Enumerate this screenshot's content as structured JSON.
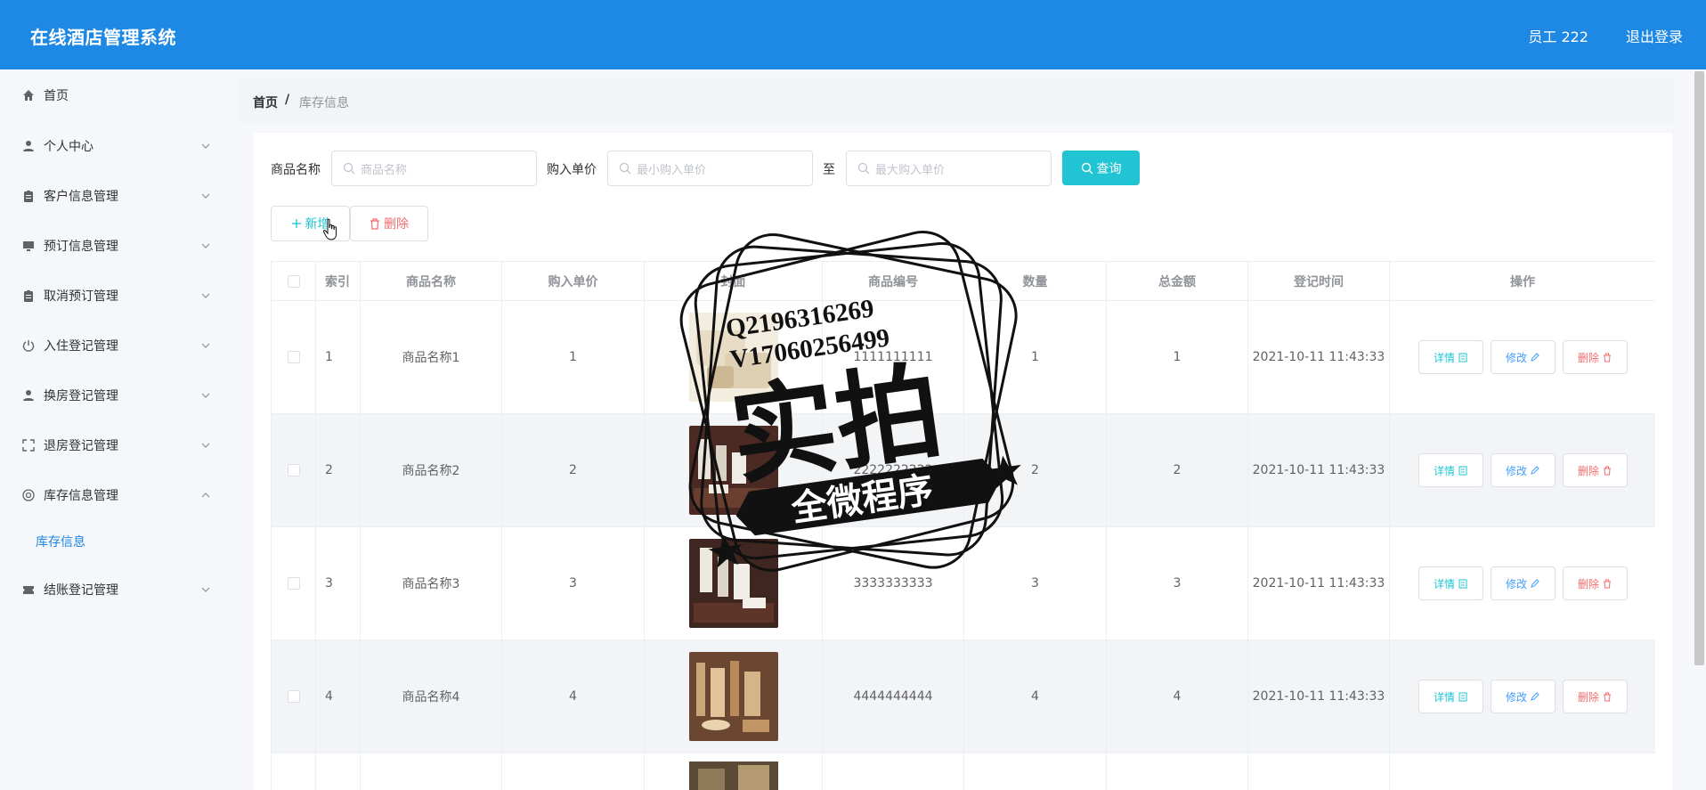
{
  "header": {
    "title": "在线酒店管理系统",
    "user": "员工 222",
    "logout": "退出登录"
  },
  "sidebar": {
    "items": [
      {
        "label": "首页",
        "icon": "home-icon",
        "expandable": false
      },
      {
        "label": "个人中心",
        "icon": "user-icon",
        "expandable": true
      },
      {
        "label": "客户信息管理",
        "icon": "clipboard-icon",
        "expandable": true
      },
      {
        "label": "预订信息管理",
        "icon": "monitor-icon",
        "expandable": true
      },
      {
        "label": "取消预订管理",
        "icon": "clipboard-icon",
        "expandable": true
      },
      {
        "label": "入住登记管理",
        "icon": "power-icon",
        "expandable": true
      },
      {
        "label": "换房登记管理",
        "icon": "user-icon",
        "expandable": true
      },
      {
        "label": "退房登记管理",
        "icon": "fullscreen-icon",
        "expandable": true
      },
      {
        "label": "库存信息管理",
        "icon": "gear-circle-icon",
        "expandable": true,
        "expanded": true
      },
      {
        "label": "结账登记管理",
        "icon": "ticket-icon",
        "expandable": true
      }
    ],
    "sub_item": "库存信息"
  },
  "breadcrumb": {
    "home": "首页",
    "separator": "/",
    "current": "库存信息"
  },
  "search": {
    "name_label": "商品名称",
    "name_placeholder": "商品名称",
    "price_label": "购入单价",
    "min_placeholder": "最小购入单价",
    "to_label": "至",
    "max_placeholder": "最大购入单价",
    "query_button": "查询"
  },
  "toolbar": {
    "add": "新增",
    "delete": "删除"
  },
  "table": {
    "columns": [
      "索引",
      "商品名称",
      "购入单价",
      "封面",
      "商品编号",
      "数量",
      "总金额",
      "登记时间",
      "操作"
    ],
    "rows": [
      {
        "index": "1",
        "name": "商品名称1",
        "price": "1",
        "code": "1111111111",
        "qty": "1",
        "total": "1",
        "time": "2021-10-11 11:43:33"
      },
      {
        "index": "2",
        "name": "商品名称2",
        "price": "2",
        "code": "2222222222",
        "qty": "2",
        "total": "2",
        "time": "2021-10-11 11:43:33"
      },
      {
        "index": "3",
        "name": "商品名称3",
        "price": "3",
        "code": "3333333333",
        "qty": "3",
        "total": "3",
        "time": "2021-10-11 11:43:33"
      },
      {
        "index": "4",
        "name": "商品名称4",
        "price": "4",
        "code": "4444444444",
        "qty": "4",
        "total": "4",
        "time": "2021-10-11 11:43:33"
      }
    ],
    "actions": {
      "detail": "详情",
      "edit": "修改",
      "remove": "删除"
    }
  },
  "watermark": {
    "line1": "Q2196316269",
    "line2": "V17060256499",
    "main": "实拍",
    "ribbon": "全微程序"
  },
  "colors": {
    "header": "#1e88e5",
    "accent": "#20c4d3",
    "danger": "#f56c6c",
    "primary": "#409eff"
  }
}
